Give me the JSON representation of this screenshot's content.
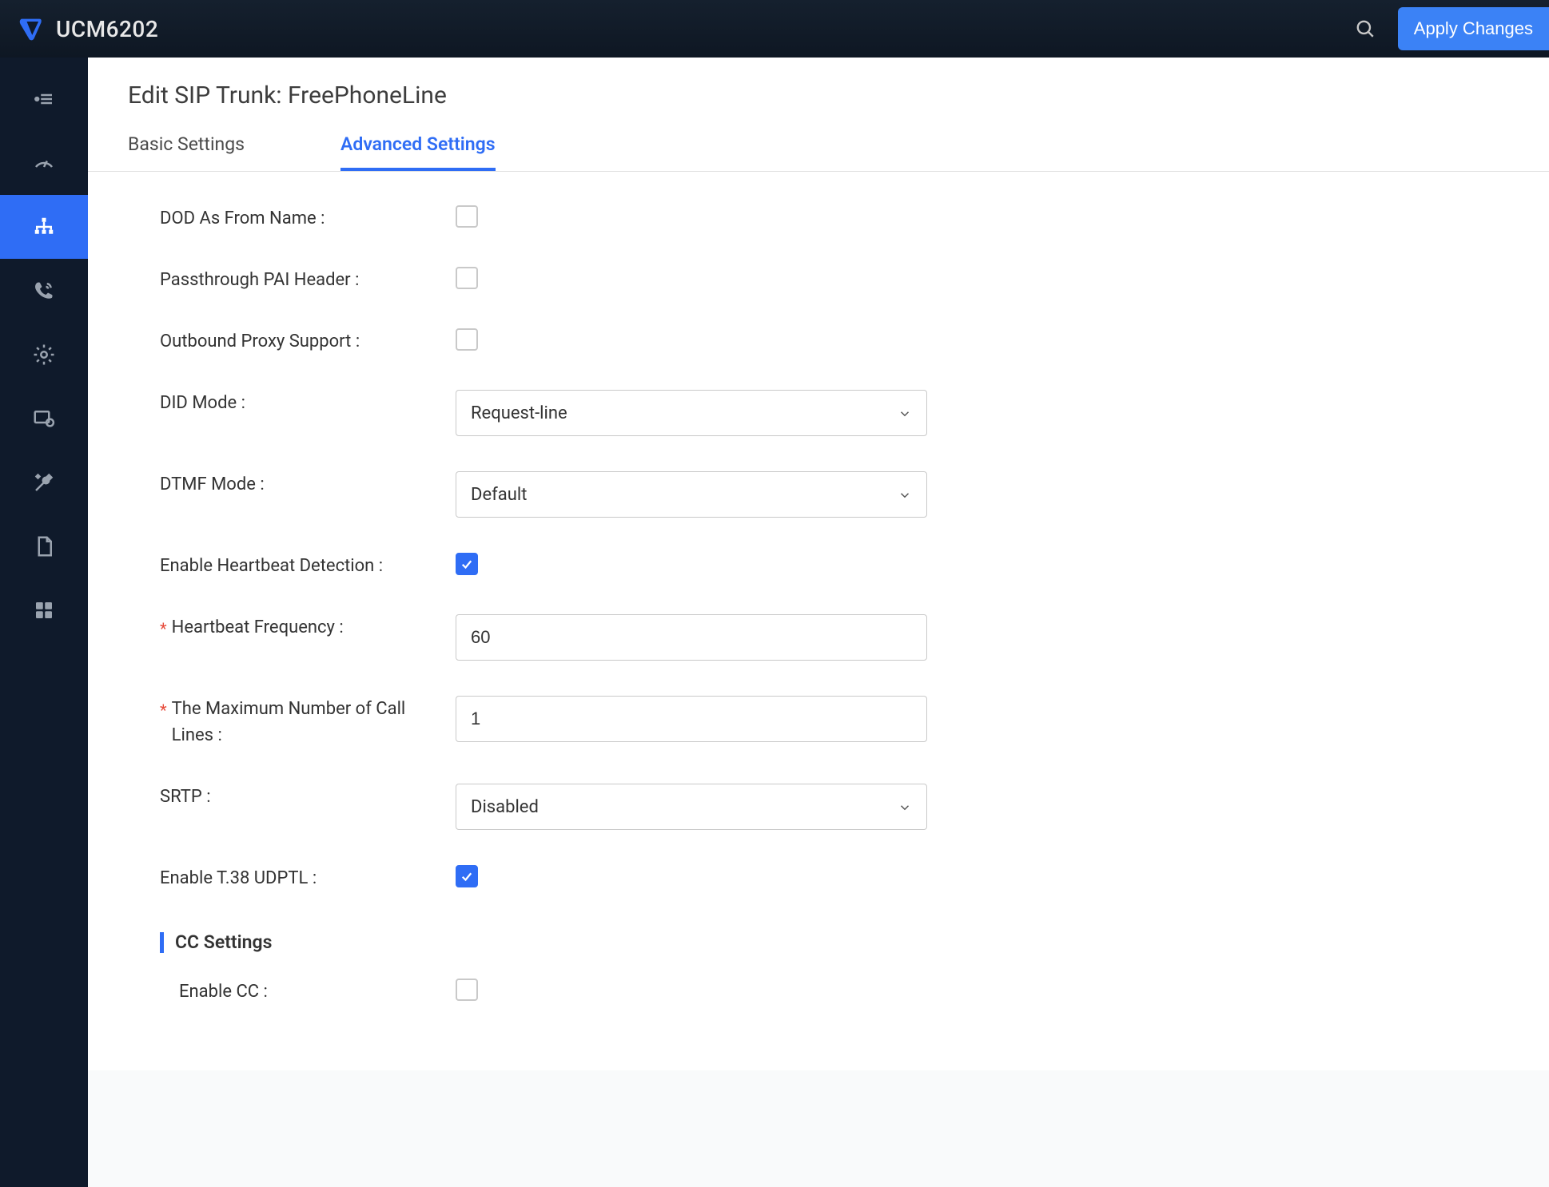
{
  "header": {
    "brand": "UCM6202",
    "apply_btn": "Apply Changes"
  },
  "page": {
    "title": "Edit SIP Trunk: FreePhoneLine"
  },
  "tabs": {
    "basic": "Basic Settings",
    "advanced": "Advanced Settings",
    "active": "advanced"
  },
  "form": {
    "dod_as_from_name": {
      "label": "DOD As From Name",
      "checked": false
    },
    "passthrough_pai": {
      "label": "Passthrough PAI Header",
      "checked": false
    },
    "outbound_proxy": {
      "label": "Outbound Proxy Support",
      "checked": false
    },
    "did_mode": {
      "label": "DID Mode",
      "value": "Request-line"
    },
    "dtmf_mode": {
      "label": "DTMF Mode",
      "value": "Default"
    },
    "enable_heartbeat": {
      "label": "Enable Heartbeat Detection",
      "checked": true
    },
    "heartbeat_freq": {
      "label": "Heartbeat Frequency",
      "value": "60",
      "required": true
    },
    "max_call_lines": {
      "label": "The Maximum Number of Call Lines",
      "value": "1",
      "required": true
    },
    "srtp": {
      "label": "SRTP",
      "value": "Disabled"
    },
    "enable_t38": {
      "label": "Enable T.38 UDPTL",
      "checked": true
    },
    "cc_section": "CC Settings",
    "enable_cc": {
      "label": "Enable CC",
      "checked": false
    }
  }
}
